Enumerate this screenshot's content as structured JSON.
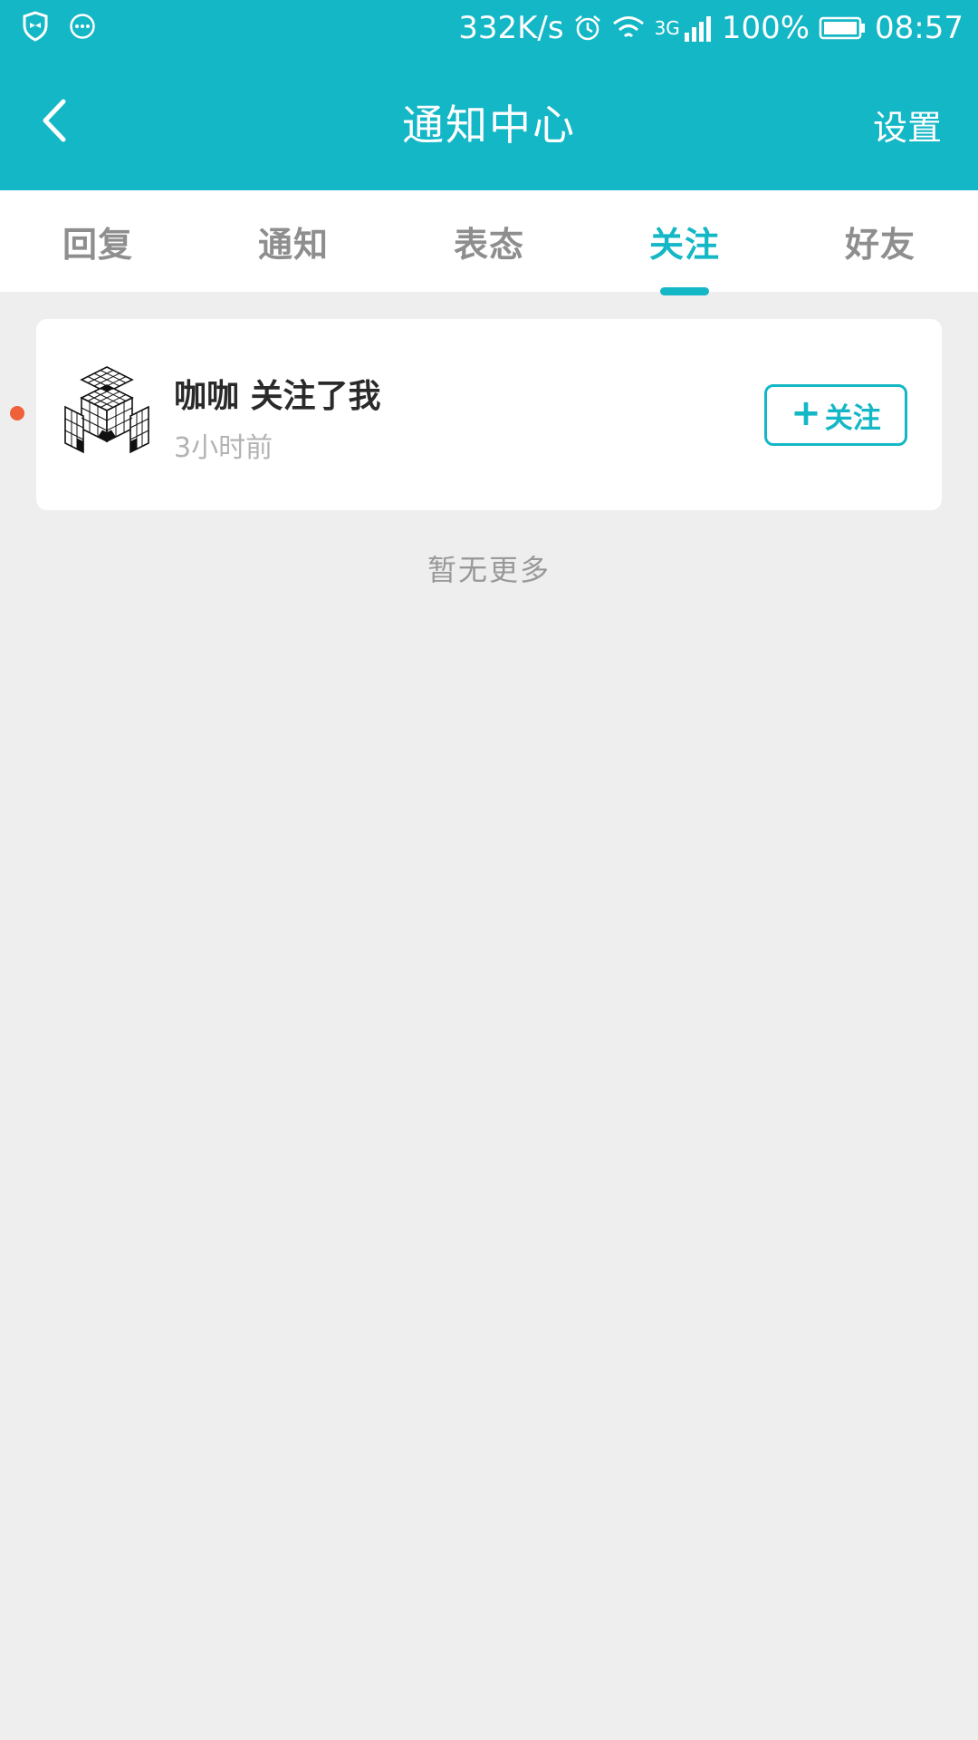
{
  "status_bar": {
    "net_speed": "332K/s",
    "network_type": "3G",
    "battery": "100%",
    "time": "08:57"
  },
  "nav": {
    "title": "通知中心",
    "settings_label": "设置"
  },
  "tabs": [
    {
      "label": "回复",
      "active": false
    },
    {
      "label": "通知",
      "active": false
    },
    {
      "label": "表态",
      "active": false
    },
    {
      "label": "关注",
      "active": true
    },
    {
      "label": "好友",
      "active": false
    }
  ],
  "notifications": [
    {
      "title": "咖咖 关注了我",
      "time": "3小时前",
      "unread": true,
      "action_label": "关注",
      "action_icon": "plus-icon"
    }
  ],
  "list_footer": "暂无更多",
  "colors": {
    "accent": "#14b7c6",
    "unread_dot": "#ee6139",
    "background": "#eeeeee"
  }
}
